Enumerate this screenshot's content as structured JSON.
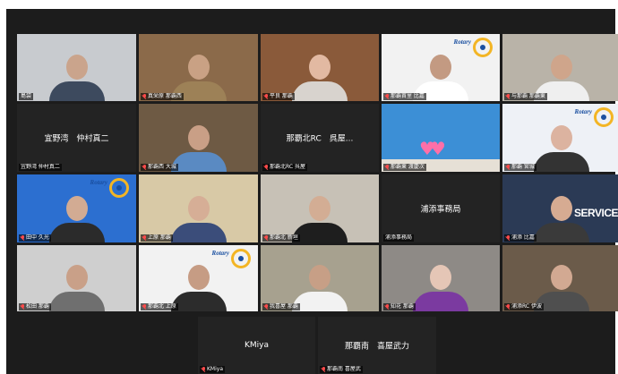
{
  "participants": [
    {
      "name": "島袋",
      "muted": false,
      "bg": "#c8cbcf",
      "skin": "#caa48c",
      "shirt": "#3d4a5e",
      "speaking": false
    },
    {
      "name": "真栄原 那覇西",
      "muted": true,
      "bg": "#8b6a4a",
      "skin": "#c9a184",
      "shirt": "#9d8157",
      "speaking": false
    },
    {
      "name": "平良 那覇",
      "muted": true,
      "bg": "#8a5a3a",
      "skin": "#e2b9a2",
      "shirt": "#d8d3ce",
      "speaking": false
    },
    {
      "name": "那覇首里 比嘉",
      "muted": true,
      "bg": "#f2f2f2",
      "skin": "#c39a82",
      "shirt": "#ffffff",
      "speaking": false,
      "rotary": "Rotary",
      "rotary_sub": "Naha-shuri Rotary Club"
    },
    {
      "name": "与那覇 那覇東",
      "muted": true,
      "bg": "#b9b3a8",
      "skin": "#cfa58b",
      "shirt": "#efefef",
      "speaking": false
    },
    {
      "name": "宜野湾 仲村真二",
      "muted": false,
      "bg": "#232323",
      "center": "宜野湾　仲村真二",
      "speaking": true
    },
    {
      "name": "那覇西 大城",
      "muted": true,
      "bg": "#6e5a44",
      "skin": "#c99f86",
      "shirt": "#5a8ac2",
      "speaking": false
    },
    {
      "name": "那覇北RC 呉屋",
      "muted": true,
      "bg": "#232323",
      "center": "那覇北RC　呉屋...",
      "speaking": false
    },
    {
      "name": "那覇東 渡慶次",
      "muted": true,
      "bg": "#3c8fd6",
      "speaking": false,
      "hearts": true
    },
    {
      "name": "那覇 宮城",
      "muted": true,
      "bg": "#eef1f6",
      "skin": "#dcb3a0",
      "shirt": "#333333",
      "speaking": false,
      "rotary": "Rotary"
    },
    {
      "name": "田中 久光",
      "muted": true,
      "bg": "#2c6fd0",
      "skin": "#d2ab93",
      "shirt": "#2b2b2b",
      "speaking": false,
      "rotary": "Rotary"
    },
    {
      "name": "上原 那覇",
      "muted": true,
      "bg": "#d8c9a6",
      "skin": "#d6ae96",
      "shirt": "#3b4d7a",
      "speaking": false
    },
    {
      "name": "那覇北 新垣",
      "muted": true,
      "bg": "#c7c1b6",
      "skin": "#d3ad94",
      "shirt": "#1e1e1e",
      "speaking": false
    },
    {
      "name": "浦添事務局",
      "muted": false,
      "bg": "#232323",
      "center": "浦添事務局",
      "speaking": false
    },
    {
      "name": "浦添 比嘉",
      "muted": true,
      "bg": "#2b3a55",
      "skin": "#d6ab92",
      "shirt": "#3a3a3a",
      "speaking": false,
      "service": "SERVICE"
    },
    {
      "name": "松田 那覇",
      "muted": true,
      "bg": "#cfcfcf",
      "skin": "#c9a088",
      "shirt": "#6f6f6f",
      "speaking": false
    },
    {
      "name": "那覇北 上原",
      "muted": true,
      "bg": "#f2f2f2",
      "skin": "#c69c84",
      "shirt": "#2c2c2c",
      "speaking": false,
      "rotary": "Rotary"
    },
    {
      "name": "我喜屋 那覇",
      "muted": true,
      "bg": "#a7a18f",
      "skin": "#c79f86",
      "shirt": "#f2f2f2",
      "speaking": false
    },
    {
      "name": "知花 那覇",
      "muted": true,
      "bg": "#8e8a86",
      "skin": "#e5c6b6",
      "shirt": "#7b3aa0",
      "speaking": false
    },
    {
      "name": "浦添RC 伊波",
      "muted": true,
      "bg": "#6b5b4a",
      "skin": "#d2a992",
      "shirt": "#4f4f4f",
      "speaking": false
    }
  ],
  "bottom": [
    {
      "name": "KMiya",
      "center": "KMiya",
      "muted": true,
      "bg": "#232323"
    },
    {
      "name": "那覇南 喜屋武",
      "center": "那覇南　喜屋武力",
      "muted": true,
      "bg": "#232323"
    }
  ]
}
